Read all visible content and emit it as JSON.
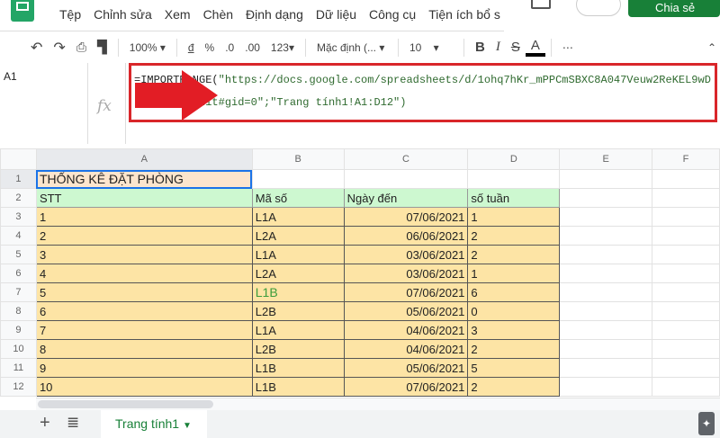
{
  "menubar": {
    "items": [
      "Tệp",
      "Chỉnh sửa",
      "Xem",
      "Chèn",
      "Định dạng",
      "Dữ liệu",
      "Công cụ",
      "Tiện ích bổ s"
    ],
    "share_label": "Chia sẻ"
  },
  "toolbar": {
    "zoom": "100%",
    "currency": "đ",
    "percent": "%",
    "dec_less": ".0",
    "dec_more": ".00",
    "format": "123▾",
    "font": "Mặc định (...",
    "font_size": "10",
    "bold": "B",
    "italic": "I",
    "strike": "S",
    "text_color": "A",
    "more": "⋯"
  },
  "namebox": "A1",
  "fx_label": "fx",
  "formula": {
    "eq": "=IMPORTRANGE(",
    "text": "\"https://docs.google.com/spreadsheets/d/1ohq7hKr_mPPCmSBXC8A047Veuw2ReKEL9wDusb3wzgI/edit#gid=0\";\"Trang tính1!A1:D12\")"
  },
  "columns": [
    "A",
    "B",
    "C",
    "D",
    "E",
    "F"
  ],
  "title": "THỐNG KÊ ĐẶT PHÒNG",
  "headers": [
    "STT",
    "Mã số",
    "Ngày đến",
    "số tuần"
  ],
  "rows": [
    [
      "1",
      "L1A",
      "07/06/2021",
      "1"
    ],
    [
      "2",
      "L2A",
      "06/06/2021",
      "2"
    ],
    [
      "3",
      "L1A",
      "03/06/2021",
      "2"
    ],
    [
      "4",
      "L2A",
      "03/06/2021",
      "1"
    ],
    [
      "5",
      "L1B",
      "07/06/2021",
      "6"
    ],
    [
      "6",
      "L2B",
      "05/06/2021",
      "0"
    ],
    [
      "7",
      "L1A",
      "04/06/2021",
      "3"
    ],
    [
      "8",
      "L2B",
      "04/06/2021",
      "2"
    ],
    [
      "9",
      "L1B",
      "05/06/2021",
      "5"
    ],
    [
      "10",
      "L1B",
      "07/06/2021",
      "2"
    ]
  ],
  "sheet_tab": "Trang tính1",
  "add_sheet": "+",
  "all_sheets": "≣"
}
